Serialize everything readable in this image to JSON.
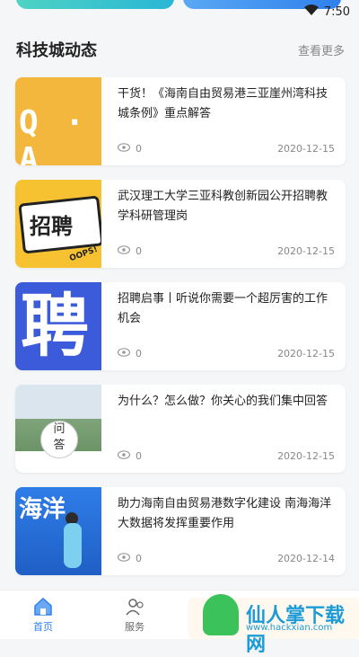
{
  "status": {
    "time": "7:50"
  },
  "section": {
    "title": "科技城动态",
    "more": "查看更多"
  },
  "news": [
    {
      "title": "干货！《海南自由贸易港三亚崖州湾科技城条例》重点解答",
      "views": "0",
      "date": "2020-12-15",
      "thumb": "Q · A"
    },
    {
      "title": "武汉理工大学三亚科教创新园公开招聘教学科研管理岗",
      "views": "0",
      "date": "2020-12-15",
      "thumb": "招聘",
      "thumb_sub": "OOPS!"
    },
    {
      "title": "招聘启事丨听说你需要一个超厉害的工作机会",
      "views": "0",
      "date": "2020-12-15",
      "thumb": "聘"
    },
    {
      "title": "为什么？怎么做？你关心的我们集中回答",
      "views": "0",
      "date": "2020-12-15",
      "thumb": "问\n答"
    },
    {
      "title": "助力海南自由贸易港数字化建设 南海海洋大数据将发挥重要作用",
      "views": "0",
      "date": "2020-12-14",
      "thumb": "海洋"
    }
  ],
  "tabs": [
    {
      "label": "首页",
      "icon": "home-icon",
      "active": true
    },
    {
      "label": "服务",
      "icon": "service-icon",
      "active": false
    }
  ],
  "watermark": {
    "brand": "仙人掌下载网",
    "url": "www.hackxian.com"
  },
  "colors": {
    "accent": "#2f80ed",
    "muted": "#888888"
  }
}
